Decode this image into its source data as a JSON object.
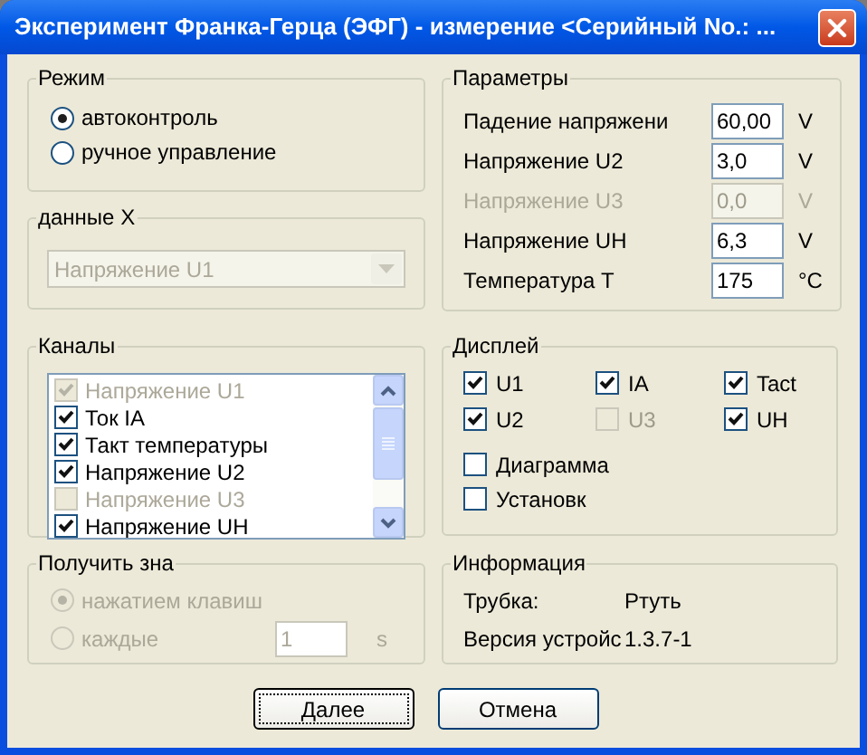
{
  "window": {
    "title": "Эксперимент Франка-Герца (ЭФГ) - измерение   <Серийный No.: ..."
  },
  "mode": {
    "title": "Режим",
    "options": [
      {
        "label": "автоконтроль",
        "selected": true
      },
      {
        "label": "ручное управление",
        "selected": false
      }
    ]
  },
  "x_data": {
    "title": "данные X",
    "value": "Напряжение U1",
    "disabled": true
  },
  "channels": {
    "title": "Каналы",
    "items": [
      {
        "label": "Напряжение U1",
        "checked": true,
        "disabled": true
      },
      {
        "label": "Ток IA",
        "checked": true,
        "disabled": false
      },
      {
        "label": "Такт температуры",
        "checked": true,
        "disabled": false
      },
      {
        "label": "Напряжение U2",
        "checked": true,
        "disabled": false
      },
      {
        "label": "Напряжение U3",
        "checked": false,
        "disabled": true
      },
      {
        "label": "Напряжение UH",
        "checked": true,
        "disabled": false
      }
    ]
  },
  "acquire": {
    "title": "Получить зна",
    "disabled": true,
    "options": [
      {
        "label": "нажатием клавиш",
        "selected": true
      },
      {
        "label": "каждые",
        "selected": false
      }
    ],
    "interval": "1",
    "unit": "s"
  },
  "parameters": {
    "title": "Параметры",
    "rows": [
      {
        "label": "Падение напряжени",
        "value": "60,00",
        "unit": "V",
        "disabled": false
      },
      {
        "label": "Напряжение U2",
        "value": "3,0",
        "unit": "V",
        "disabled": false
      },
      {
        "label": "Напряжение U3",
        "value": "0,0",
        "unit": "V",
        "disabled": true
      },
      {
        "label": "Напряжение UH",
        "value": "6,3",
        "unit": "V",
        "disabled": false
      },
      {
        "label": "Температура T",
        "value": "175",
        "unit": "°C",
        "disabled": false
      }
    ]
  },
  "display": {
    "title": "Дисплей",
    "signals": [
      {
        "label": "U1",
        "checked": true,
        "disabled": false
      },
      {
        "label": "IA",
        "checked": true,
        "disabled": false
      },
      {
        "label": "Tact",
        "checked": true,
        "disabled": false
      },
      {
        "label": "U2",
        "checked": true,
        "disabled": false
      },
      {
        "label": "U3",
        "checked": false,
        "disabled": true
      },
      {
        "label": "UH",
        "checked": true,
        "disabled": false
      }
    ],
    "options": [
      {
        "label": "Диаграмма",
        "checked": false
      },
      {
        "label": "Установк",
        "checked": false
      }
    ]
  },
  "info": {
    "title": "Информация",
    "rows": [
      {
        "label": "Трубка:",
        "value": "Ртуть"
      },
      {
        "label": "Версия устройс",
        "value": "1.3.7-1"
      }
    ]
  },
  "buttons": [
    {
      "label": "Далее",
      "default": true
    },
    {
      "label": "Отмена",
      "default": false
    }
  ]
}
